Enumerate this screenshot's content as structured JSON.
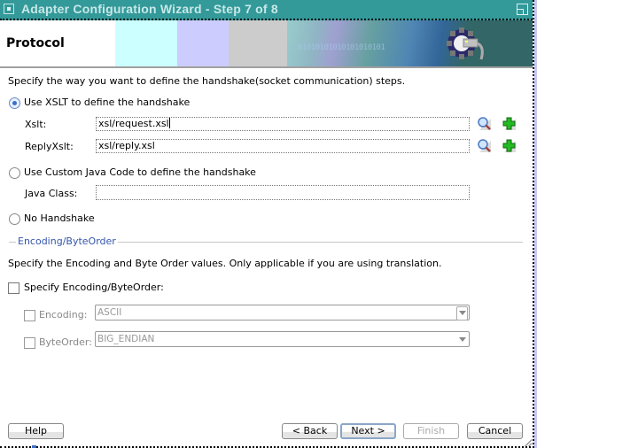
{
  "window": {
    "title": "Adapter Configuration Wizard - Step 7 of 8",
    "system_menu_icon": "window-menu-icon",
    "maximize_icon": "maximize-icon"
  },
  "banner": {
    "page_title": "Protocol",
    "graphic_text": "01010101010101010101",
    "graphic_icon": "gear-plug-icon"
  },
  "handshake": {
    "instruction": "Specify the way you want to define the handshake(socket communication) steps.",
    "options": [
      {
        "label": "Use XSLT to define the handshake",
        "selected": true
      },
      {
        "label": "Use Custom Java Code to define the handshake",
        "selected": false
      },
      {
        "label": "No Handshake",
        "selected": false
      }
    ],
    "xslt_label": "Xslt:",
    "xslt_value": "xsl/request.xsl",
    "reply_xslt_label": "ReplyXslt:",
    "reply_xslt_value": "xsl/reply.xsl",
    "java_class_label": "Java Class:",
    "java_class_value": "",
    "browse_icon": "search-icon",
    "add_icon": "add-icon"
  },
  "encoding": {
    "section_title": "Encoding/ByteOrder",
    "instruction": "Specify the Encoding and Byte Order values. Only applicable if you are using translation.",
    "specify_label": "Specify Encoding/ByteOrder:",
    "specify_checked": false,
    "encoding_label": "Encoding:",
    "encoding_value": "ASCII",
    "byteorder_label": "ByteOrder:",
    "byteorder_value": "BIG_ENDIAN"
  },
  "buttons": {
    "help": "Help",
    "back": "< Back",
    "next": "Next >",
    "finish": "Finish",
    "cancel": "Cancel"
  },
  "colors": {
    "titlebar": "#339999",
    "section_title": "#3355aa",
    "radio_selected": "#3a6ec8"
  }
}
